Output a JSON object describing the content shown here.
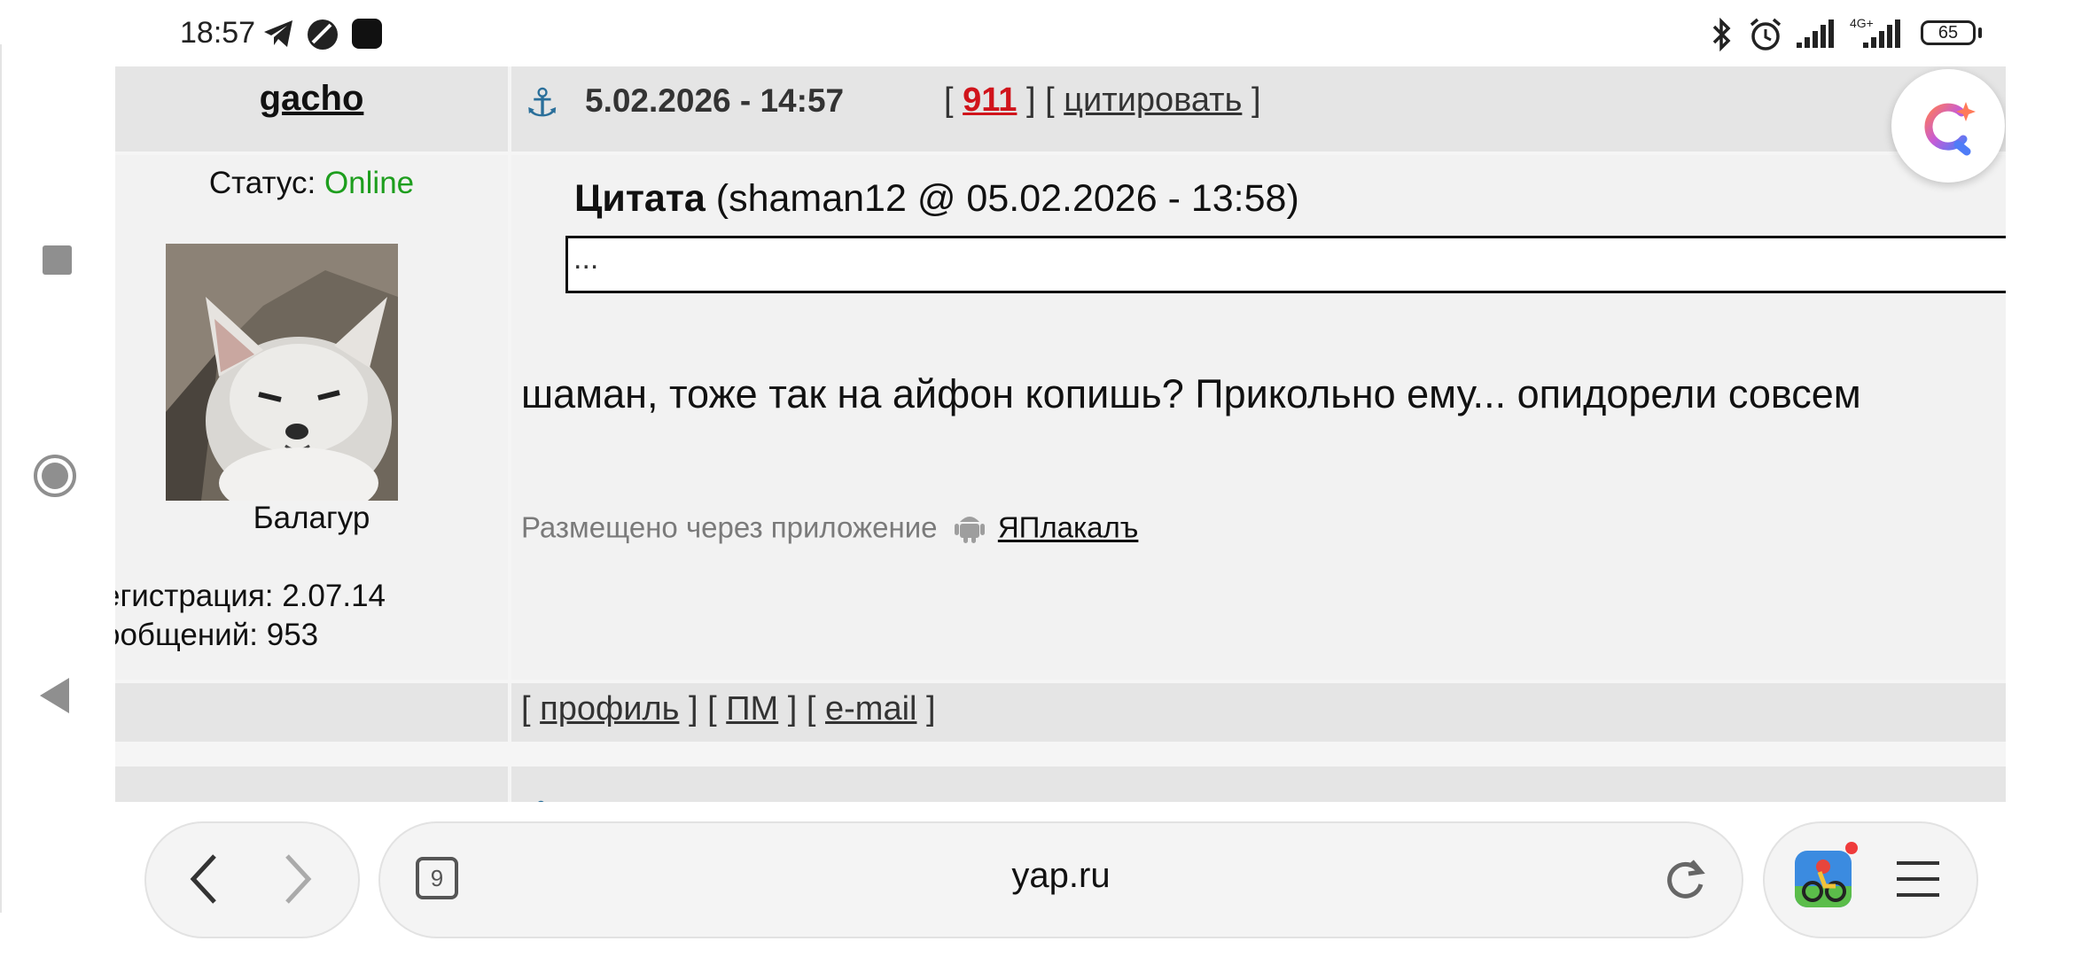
{
  "status_bar": {
    "time": "18:57",
    "battery": "65",
    "network_label": "4G+",
    "left_icons": [
      "telegram-icon",
      "signal-app-icon",
      "app-square-icon"
    ],
    "right_icons": [
      "bluetooth-icon",
      "alarm-icon",
      "cell-signal-icon",
      "cell-signal-4g-icon",
      "battery-icon"
    ]
  },
  "post": {
    "author": "gacho",
    "date": "5.02.2026 - 14:57",
    "post_number": "911",
    "quote_action": "цитировать",
    "status_label": "Статус: ",
    "status_value": "Online",
    "rank": "Балагур",
    "registration": "егистрация: 2.07.14",
    "messages": "ообщений: 953",
    "quote_label": "Цитата",
    "quote_source": " (shaman12 @ 05.02.2026 - 13:58)",
    "quote_text": "...",
    "text": "шаман, тоже так на айфон копишь? Прикольно ему... опидорели совсем",
    "posted_via": "Размещено через приложение",
    "app_name": "ЯПлакалъ"
  },
  "footer": {
    "profile": "профиль",
    "pm": "ПМ",
    "email": "e-mail"
  },
  "browser": {
    "url": "yap.ru",
    "tab_count": "9"
  },
  "colors": {
    "online": "#1e9e1e",
    "post_number": "#d0141b",
    "cell_dark": "#e5e5e5",
    "cell_light": "#f2f2f2"
  }
}
